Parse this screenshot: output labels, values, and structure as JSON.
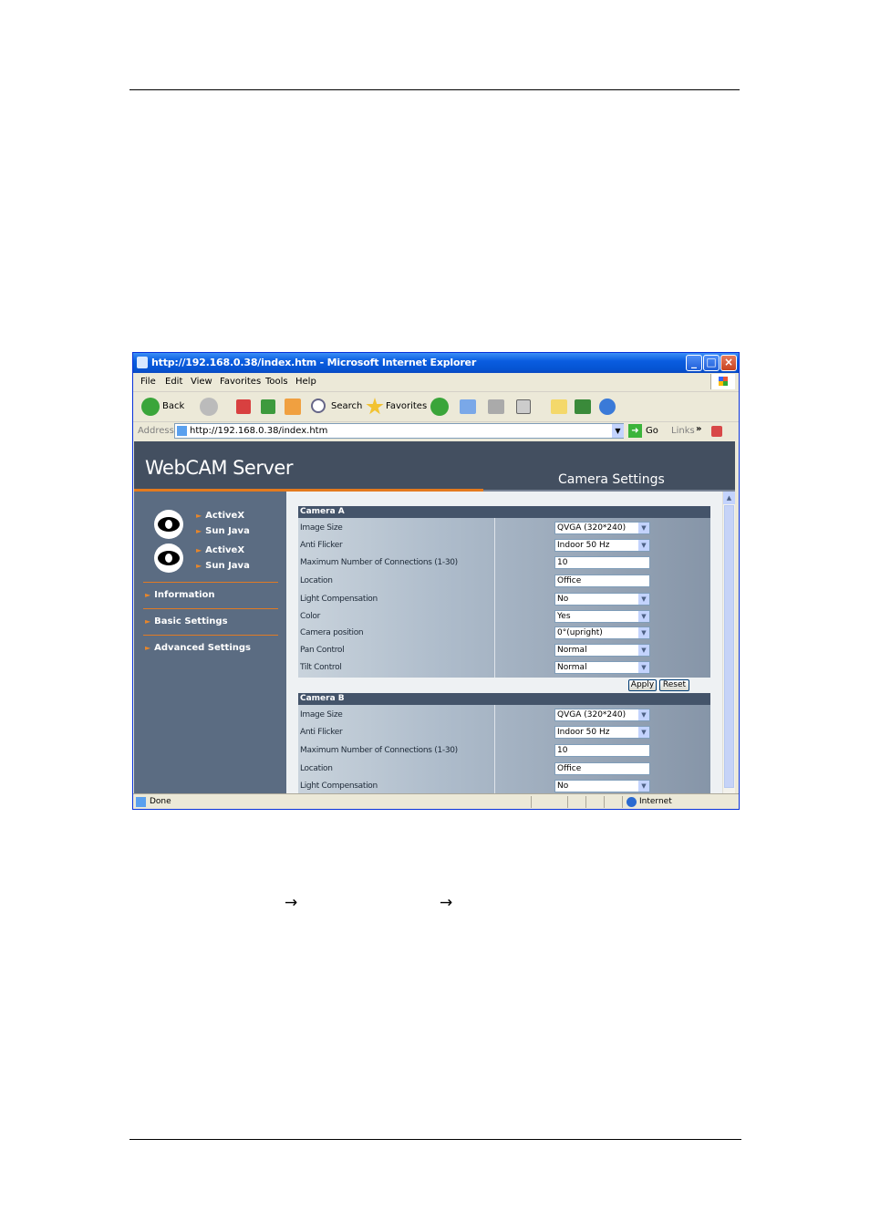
{
  "browser": {
    "title": "http://192.168.0.38/index.htm - Microsoft Internet Explorer",
    "menu": [
      "File",
      "Edit",
      "View",
      "Favorites",
      "Tools",
      "Help"
    ],
    "toolbar": {
      "back": "Back",
      "search": "Search",
      "favorites": "Favorites"
    },
    "address_label": "Address",
    "address_value": "http://192.168.0.38/index.htm",
    "go_label": "Go",
    "links_label": "Links",
    "status_text": "Done",
    "zone_text": "Internet"
  },
  "page": {
    "brand": "WebCAM Server",
    "subtitle": "Camera Settings",
    "sidebar": {
      "camera1": {
        "activex": "ActiveX",
        "java": "Sun Java"
      },
      "camera2": {
        "activex": "ActiveX",
        "java": "Sun Java"
      },
      "nav": [
        "Information",
        "Basic Settings",
        "Advanced Settings"
      ]
    },
    "camera_a": {
      "header": "Camera A",
      "rows": [
        {
          "label": "Image Size",
          "value": "QVGA (320*240)",
          "kind": "select"
        },
        {
          "label": "Anti Flicker",
          "value": "Indoor 50 Hz",
          "kind": "select"
        },
        {
          "label": "Maximum Number of Connections (1-30)",
          "value": "10",
          "kind": "text"
        },
        {
          "label": "Location",
          "value": "Office",
          "kind": "text"
        },
        {
          "label": "Light Compensation",
          "value": "No",
          "kind": "select"
        },
        {
          "label": "Color",
          "value": "Yes",
          "kind": "select"
        },
        {
          "label": "Camera position",
          "value": "0°(upright)",
          "kind": "select"
        },
        {
          "label": "Pan Control",
          "value": "Normal",
          "kind": "select"
        },
        {
          "label": "Tilt Control",
          "value": "Normal",
          "kind": "select"
        }
      ],
      "apply": "Apply",
      "reset": "Reset"
    },
    "camera_b": {
      "header": "Camera B",
      "rows": [
        {
          "label": "Image Size",
          "value": "QVGA (320*240)",
          "kind": "select"
        },
        {
          "label": "Anti Flicker",
          "value": "Indoor 50 Hz",
          "kind": "select"
        },
        {
          "label": "Maximum Number of Connections (1-30)",
          "value": "10",
          "kind": "text"
        },
        {
          "label": "Location",
          "value": "Office",
          "kind": "text"
        },
        {
          "label": "Light Compensation",
          "value": "No",
          "kind": "select"
        }
      ]
    }
  },
  "doc": {
    "arrow": "→"
  }
}
